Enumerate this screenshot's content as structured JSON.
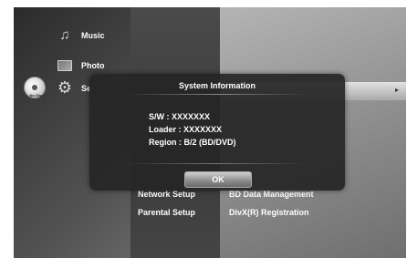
{
  "main_menu": {
    "items": [
      {
        "label": "Music",
        "icon": "music-note-icon"
      },
      {
        "label": "Photo",
        "icon": "photo-icon"
      },
      {
        "label": "Se",
        "icon": "gear-icon"
      }
    ]
  },
  "disc": {
    "label": "No Disc",
    "icon": "disc-icon"
  },
  "settings_menu": {
    "left": [
      "Network Setup",
      "Parental Setup"
    ],
    "right": [
      "BD Data Management",
      "DivX(R) Registration"
    ],
    "highlight_arrow": "▸"
  },
  "dialog": {
    "title": "System Information",
    "lines": [
      "S/W : XXXXXXX",
      "Loader : XXXXXXX",
      "Region : B/2 (BD/DVD)"
    ],
    "ok_label": "OK"
  }
}
